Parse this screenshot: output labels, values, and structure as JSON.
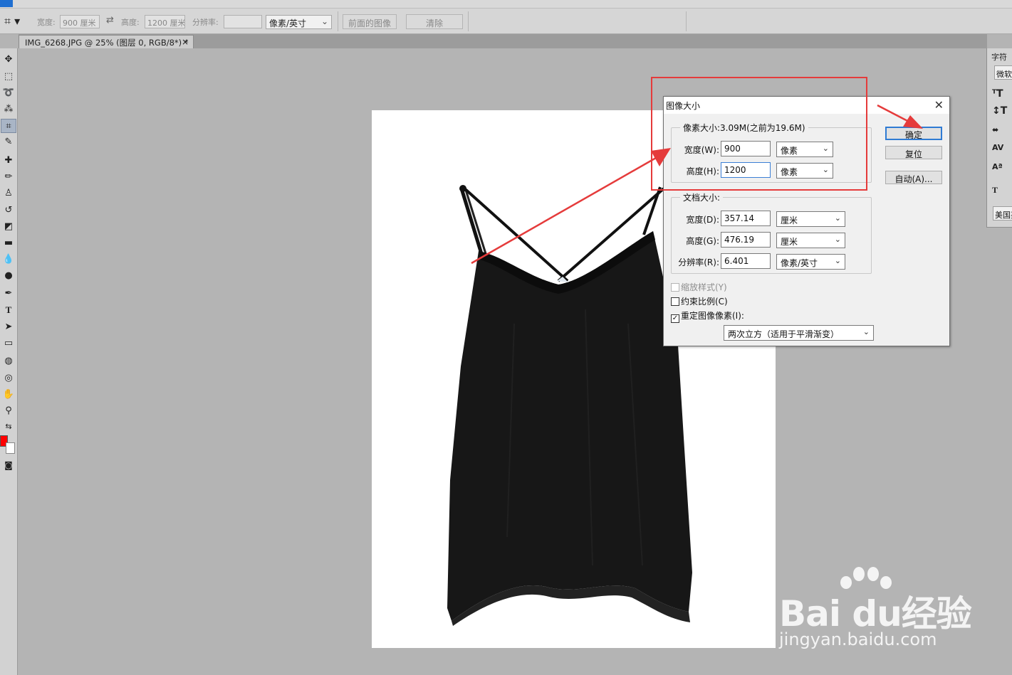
{
  "options_bar": {
    "width_label": "宽度:",
    "width_value": "900 厘米",
    "swap_icon": "⇄",
    "height_label": "高度:",
    "height_value": "1200 厘米",
    "resolution_label": "分辨率:",
    "resolution_value": "",
    "resolution_unit": "像素/英寸",
    "front_image_button": "前面的图像",
    "clear_button": "清除"
  },
  "document_tab": {
    "title": "IMG_6268.JPG @ 25% (图层 0, RGB/8*) *",
    "close": "×"
  },
  "character_panel": {
    "title": "字符",
    "font": "微软雅黑",
    "language": "美国英语"
  },
  "colors": {
    "foreground": "#ff0000",
    "background": "#ffffff",
    "annotation": "#e53b3b"
  },
  "dialog": {
    "title": "图像大小",
    "close": "✕",
    "pixel_dimensions": {
      "legend": "像素大小:3.09M(之前为19.6M)",
      "width_label": "宽度(W):",
      "width_value": "900",
      "width_unit": "像素",
      "height_label": "高度(H):",
      "height_value": "1200",
      "height_unit": "像素"
    },
    "document_size": {
      "legend": "文档大小:",
      "width_label": "宽度(D):",
      "width_value": "357.14",
      "width_unit": "厘米",
      "height_label": "高度(G):",
      "height_value": "476.19",
      "height_unit": "厘米",
      "resolution_label": "分辨率(R):",
      "resolution_value": "6.401",
      "resolution_unit": "像素/英寸"
    },
    "scale_styles": "缩放样式(Y)",
    "constrain_proportions": "约束比例(C)",
    "resample_image": "重定图像像素(I):",
    "resample_method": "两次立方（适用于平滑渐变）",
    "ok_button": "确定",
    "reset_button": "复位",
    "auto_button": "自动(A)..."
  },
  "watermark": {
    "brand": "Bai du经验",
    "url": "jingyan.baidu.com"
  }
}
